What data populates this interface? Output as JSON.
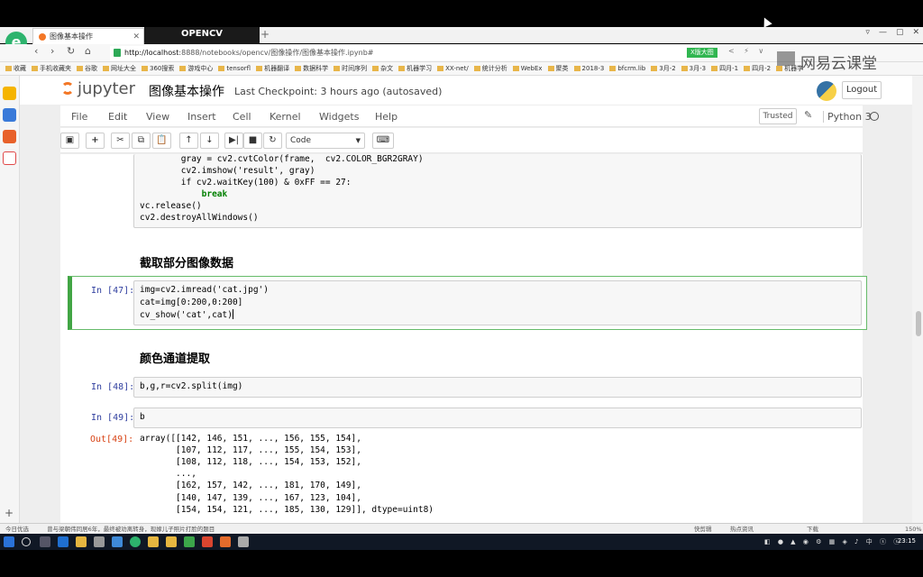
{
  "browser": {
    "tab_title": "图像基本操作",
    "tab_overlay_title": "OPENCV",
    "new_tab": "+",
    "url_host": "http://localhost",
    "url_path": ":8888/notebooks/opencv/图像操作/图像基本操作.ipynb#",
    "extension_badge": "X版大图",
    "window_controls": [
      "▿",
      "—",
      "▢",
      "✕"
    ],
    "bookmarks": [
      "收藏",
      "手机收藏夹",
      "谷歌",
      "网址大全",
      "360搜索",
      "游戏中心",
      "tensorfl",
      "机器翻译",
      "数据科学",
      "时间序列",
      "杂文",
      "机器学习",
      "XX-net/",
      "统计分析",
      "WebEx",
      "聚类",
      "2018-3",
      "bfcrm.lib",
      "3月-2",
      "3月-3",
      "四月-1",
      "四月-2",
      "机器学"
    ]
  },
  "watermark": "网易云课堂",
  "jupyter": {
    "logo_text": "jupyter",
    "notebook_title": "图像基本操作",
    "checkpoint": "Last Checkpoint: 3 hours ago (autosaved)",
    "logout": "Logout",
    "menu": [
      "File",
      "Edit",
      "View",
      "Insert",
      "Cell",
      "Kernel",
      "Widgets",
      "Help"
    ],
    "trusted": "Trusted",
    "kernel_name": "Python 3",
    "cell_type": "Code"
  },
  "cells": {
    "top_code": [
      "        gray = cv2.cvtColor(frame,  cv2.COLOR_BGR2GRAY)",
      "        cv2.imshow('result', gray)",
      "        if cv2.waitKey(100) & 0xFF == 27:",
      "            break",
      "vc.release()",
      "cv2.destroyAllWindows()"
    ],
    "heading1": "截取部分图像数据",
    "cell47_prompt": "In [47]:",
    "cell47_lines": [
      "img=cv2.imread('cat.jpg')",
      "cat=img[0:200,0:200]",
      "cv_show('cat',cat)"
    ],
    "heading2": "颜色通道提取",
    "cell48_prompt": "In [48]:",
    "cell48_code": "b,g,r=cv2.split(img)",
    "cell49_prompt": "In [49]:",
    "cell49_code": "b",
    "out49_prompt": "Out[49]:",
    "out49_lines": [
      "array([[142, 146, 151, ..., 156, 155, 154],",
      "       [107, 112, 117, ..., 155, 154, 153],",
      "       [108, 112, 118, ..., 154, 153, 152],",
      "       ...,",
      "       [162, 157, 142, ..., 181, 170, 149],",
      "       [140, 147, 139, ..., 167, 123, 104],",
      "       [154, 154, 121, ..., 185, 130, 129]], dtype=uint8)"
    ]
  },
  "statusbar": {
    "left": "今日优选",
    "news": "曾与梁朝伟同居6年，最终被劝离转身，现嫁儿子照片打脸的题目",
    "right_items": [
      "快剪辑",
      "热点资讯",
      "下载",
      "150%"
    ]
  },
  "taskbar": {
    "clock": "23:15"
  },
  "colors": {
    "jupyter_orange": "#f37726",
    "selected_cell_border": "#42a545",
    "in_prompt": "#303f9f",
    "out_prompt": "#d84315"
  }
}
